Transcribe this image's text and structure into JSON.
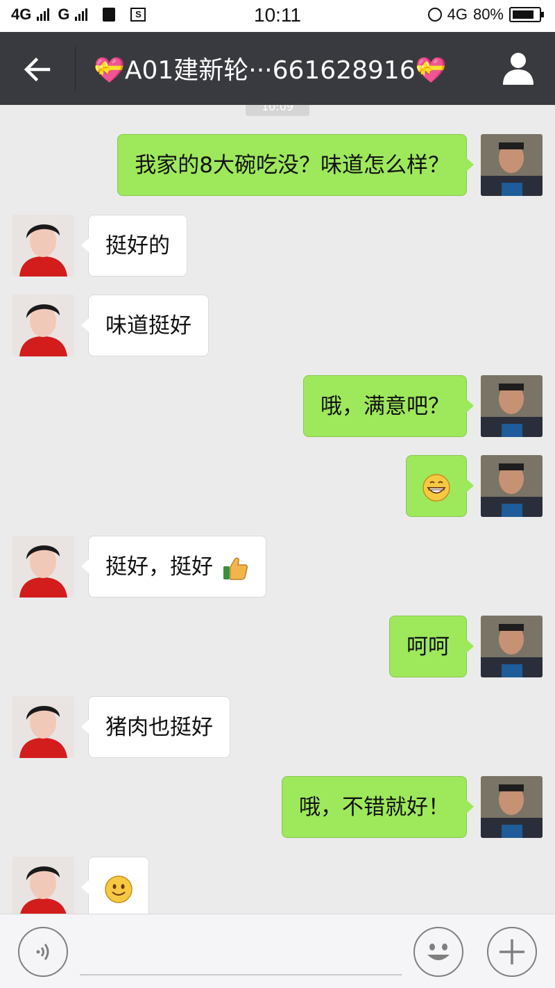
{
  "status_bar": {
    "network_left": "4G",
    "network_left2": "G",
    "time": "10:11",
    "network_right": "4G",
    "battery_percent": "80%",
    "battery_level": 0.8
  },
  "header": {
    "title": "💝A01建新轮···661628916💝",
    "back_icon": "arrow-left-icon",
    "profile_icon": "person-icon"
  },
  "chat": {
    "timestamp": "10:09",
    "messages": [
      {
        "side": "right",
        "text": "我家的8大碗吃没？味道怎么样？"
      },
      {
        "side": "left",
        "text": "挺好的"
      },
      {
        "side": "left",
        "text": "味道挺好"
      },
      {
        "side": "right",
        "text": "哦，满意吧？"
      },
      {
        "side": "right",
        "emoji": "grinning-face"
      },
      {
        "side": "left",
        "text": "挺好，挺好",
        "emoji": "thumbs-up"
      },
      {
        "side": "right",
        "text": "呵呵"
      },
      {
        "side": "left",
        "text": "猪肉也挺好"
      },
      {
        "side": "right",
        "text": "哦，不错就好！"
      },
      {
        "side": "left",
        "emoji": "smiling-face"
      }
    ]
  },
  "input_bar": {
    "voice_icon": "voice-icon",
    "emoji_icon": "smiley-icon",
    "plus_icon": "plus-icon"
  },
  "colors": {
    "title_bar": "#393a3f",
    "chat_bg": "#ebebeb",
    "bubble_right": "#9ee85b",
    "bubble_left": "#ffffff"
  }
}
